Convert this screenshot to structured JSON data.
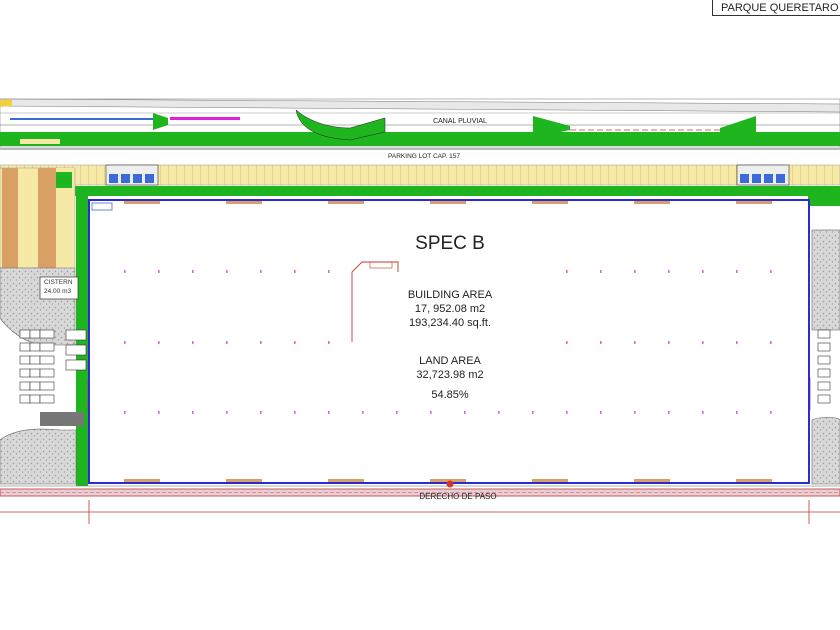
{
  "title_block": {
    "project": "PARQUE QUERETARO"
  },
  "building": {
    "name": "SPEC B",
    "building_area_label": "BUILDING AREA",
    "building_area_m2": "17, 952.08 m2",
    "building_area_sqft": "193,234.40 sq.ft.",
    "land_area_label": "LAND AREA",
    "land_area_m2": "32,723.98 m2",
    "coverage": "54.85%"
  },
  "site_labels": {
    "canal": "CANAL PLUVIAL",
    "parking": "PARKING LOT CAP. 157",
    "cistern": "CISTERN",
    "cistern_volume": "24.00 m3",
    "right_of_way": "DERECHO DE PASO"
  },
  "colors": {
    "green": "#1fb51f",
    "building_outline": "#2a2ad6",
    "dock_fill": "#d9a066",
    "column_marks": "#d36fd3",
    "property_line": "#c0392b",
    "canal_magenta": "#e01ee0",
    "road_gray": "#cfcfcf"
  },
  "icons": [
    "truck-dock-icon",
    "door-icon"
  ]
}
